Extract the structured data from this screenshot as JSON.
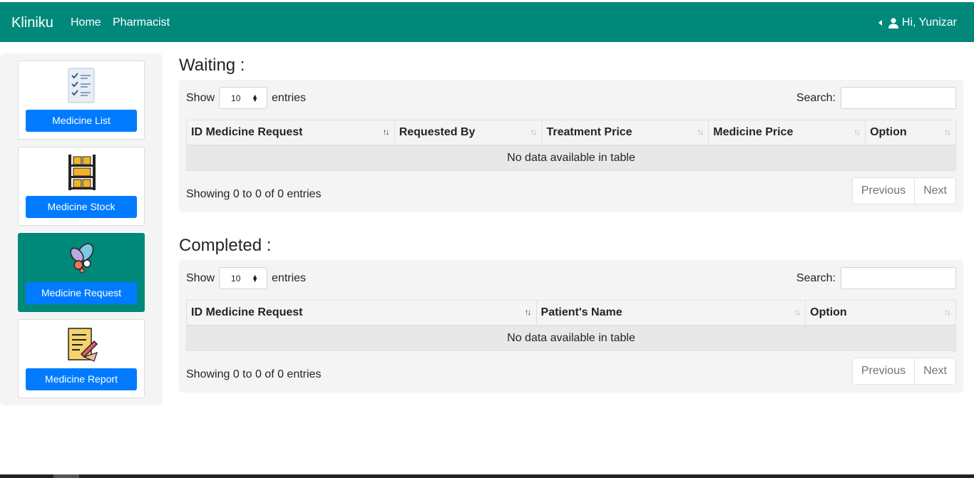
{
  "nav": {
    "brand": "Kliniku",
    "home": "Home",
    "pharmacist": "Pharmacist",
    "user": "Hi, Yunizar"
  },
  "sidebar": {
    "items": [
      {
        "label": "Medicine List",
        "icon": "checklist-icon",
        "active": false
      },
      {
        "label": "Medicine Stock",
        "icon": "shelf-boxes-icon",
        "active": false
      },
      {
        "label": "Medicine Request",
        "icon": "pills-icon",
        "active": true
      },
      {
        "label": "Medicine Report",
        "icon": "report-sign-icon",
        "active": false
      }
    ]
  },
  "waiting": {
    "title": "Waiting :",
    "show_label": "Show",
    "entries_value": "10",
    "entries_label": "entries",
    "search_label": "Search:",
    "columns": [
      "ID Medicine Request",
      "Requested By",
      "Treatment Price",
      "Medicine Price",
      "Option"
    ],
    "empty": "No data available in table",
    "info": "Showing 0 to 0 of 0 entries",
    "prev": "Previous",
    "next": "Next"
  },
  "completed": {
    "title": "Completed :",
    "show_label": "Show",
    "entries_value": "10",
    "entries_label": "entries",
    "search_label": "Search:",
    "columns": [
      "ID Medicine Request",
      "Patient's Name",
      "Option"
    ],
    "empty": "No data available in table",
    "info": "Showing 0 to 0 of 0 entries",
    "prev": "Previous",
    "next": "Next"
  },
  "colors": {
    "navbar": "#00897b",
    "button": "#007bff",
    "active_card": "#00897b"
  }
}
